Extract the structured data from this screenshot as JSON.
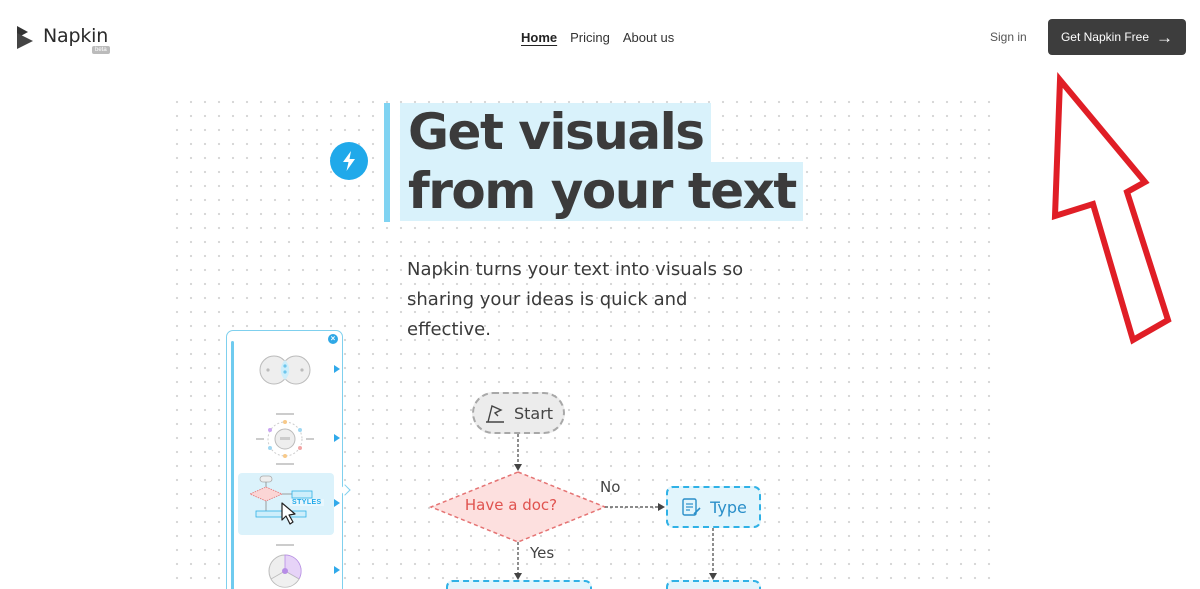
{
  "header": {
    "brand": "Napkin",
    "beta_badge": "beta",
    "nav": [
      {
        "label": "Home",
        "active": true
      },
      {
        "label": "Pricing",
        "active": false
      },
      {
        "label": "About us",
        "active": false
      }
    ],
    "sign_in": "Sign in",
    "cta_label": "Get Napkin Free"
  },
  "hero": {
    "headline_line1": "Get visuals",
    "headline_line2": "from your text",
    "subtitle": "Napkin turns your text into visuals so sharing your ideas is quick and effective.",
    "icon": "lightning-bolt-icon"
  },
  "styles_panel": {
    "tag": "STYLES",
    "thumbnails": [
      "venn-style",
      "cycle-style",
      "flowchart-style",
      "pie-style"
    ],
    "selected_index": 2
  },
  "flowchart": {
    "start": "Start",
    "decision": "Have a doc?",
    "no_label": "No",
    "yes_label": "Yes",
    "type_node": "Type"
  },
  "colors": {
    "accent_blue": "#20a9ea",
    "highlight": "#d9f2fb",
    "cta_bg": "#3d3d3d",
    "decision_red": "#e0534f",
    "annotation_red": "#e01e26"
  }
}
